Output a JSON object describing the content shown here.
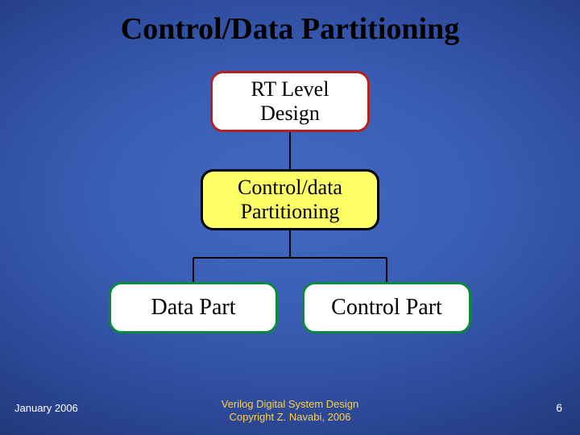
{
  "title": "Control/Data Partitioning",
  "nodes": {
    "rt": {
      "line1": "RT Level",
      "line2": "Design"
    },
    "part": {
      "line1": "Control/data",
      "line2": "Partitioning"
    },
    "data": {
      "label": "Data Part"
    },
    "ctrl": {
      "label": "Control Part"
    }
  },
  "footer": {
    "date": "January 2006",
    "credit_line1": "Verilog Digital System Design",
    "credit_line2": "Copyright Z. Navabi, 2006",
    "page": "6"
  }
}
